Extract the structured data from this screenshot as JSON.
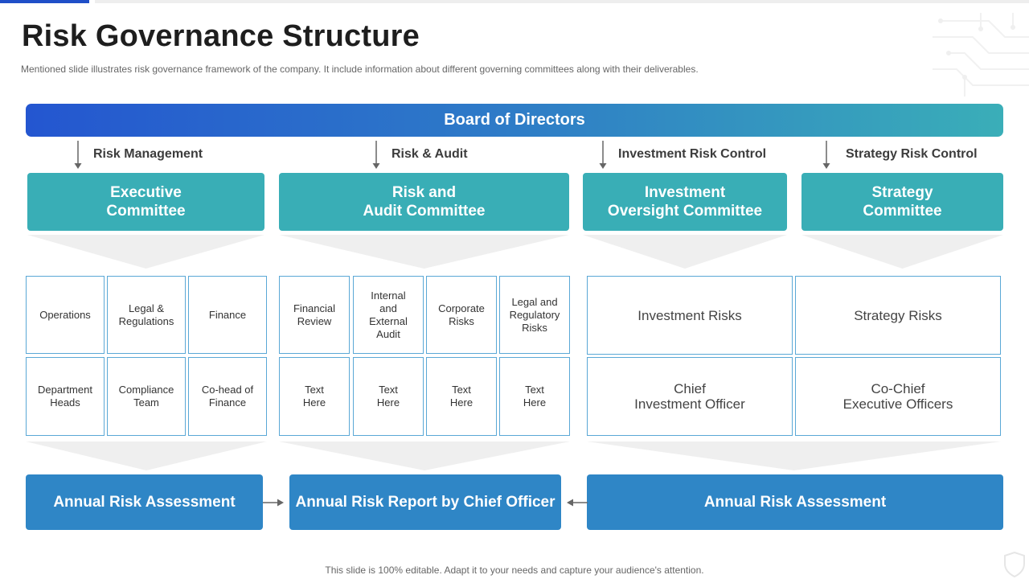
{
  "slide": {
    "title": "Risk Governance Structure",
    "subtitle": "Mentioned slide illustrates risk governance  framework  of the company. It include information about different governing  committees along with their deliverables.",
    "footer": "This slide is 100% editable. Adapt it to your needs and capture your audience's attention."
  },
  "colors": {
    "title_accent": "#1f4fc8",
    "board_gradient_start": "#2456d0",
    "board_gradient_end": "#3aaeb8",
    "committee": "#39aeb6",
    "output": "#2f86c6",
    "cell_border": "#5aa8d6"
  },
  "board": {
    "label": "Board of Directors"
  },
  "links": [
    {
      "label": "Risk Management"
    },
    {
      "label": "Risk & Audit"
    },
    {
      "label": "Investment Risk Control"
    },
    {
      "label": "Strategy Risk Control"
    }
  ],
  "committees": [
    {
      "label": "Executive\nCommittee"
    },
    {
      "label": "Risk and\nAudit Committee"
    },
    {
      "label": "Investment\nOversight Committee"
    },
    {
      "label": "Strategy\nCommittee"
    }
  ],
  "grids": {
    "executive": {
      "row1": [
        "Operations",
        "Legal &\nRegulations",
        "Finance"
      ],
      "row2": [
        "Department\nHeads",
        "Compliance\nTeam",
        "Co-head of\nFinance"
      ]
    },
    "audit": {
      "row1": [
        "Financial\nReview",
        "Internal\nand\nExternal\nAudit",
        "Corporate\nRisks",
        "Legal and\nRegulatory\nRisks"
      ],
      "row2": [
        "Text\nHere",
        "Text\nHere",
        "Text\nHere",
        "Text\nHere"
      ]
    },
    "investment": {
      "row1": [
        "Investment Risks"
      ],
      "row2": [
        "Chief\nInvestment Officer"
      ]
    },
    "strategy": {
      "row1": [
        "Strategy Risks"
      ],
      "row2": [
        "Co-Chief\nExecutive Officers"
      ]
    }
  },
  "outputs": [
    {
      "label": "Annual Risk Assessment"
    },
    {
      "label": "Annual Risk Report by Chief Officer"
    },
    {
      "label": "Annual Risk Assessment"
    }
  ],
  "icons": {
    "corner": "circuit-pattern-icon",
    "footer": "shield-icon"
  }
}
